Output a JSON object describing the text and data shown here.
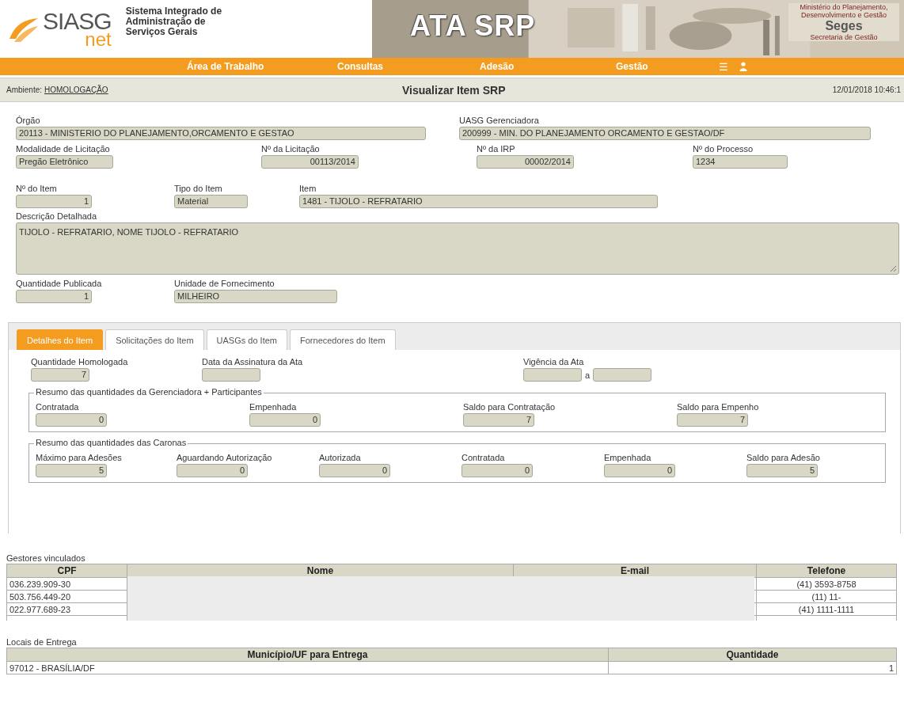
{
  "header": {
    "logo": {
      "text": "SIASG",
      "sub": "net"
    },
    "system_name": [
      "Sistema Integrado de",
      "Administração de",
      "Serviços Gerais"
    ],
    "banner_title": "ATA SRP",
    "ministry": {
      "lines": [
        "Ministério do Planejamento,",
        "Desenvolvimento e Gestão"
      ],
      "name": "Seges",
      "subtitle": "Secretaria de Gestão"
    }
  },
  "nav": {
    "items": [
      "Área de Trabalho",
      "Consultas",
      "Adesão",
      "Gestão"
    ],
    "menu_glyph": "☰"
  },
  "subbar": {
    "ambiente_label": "Ambiente:",
    "ambiente_value": "HOMOLOGAÇÃO",
    "title": "Visualizar Item SRP",
    "datetime": "12/01/2018 10:46:1"
  },
  "form": {
    "rows": [
      [
        {
          "label": "Órgão",
          "value": "20113 - MINISTERIO DO PLANEJAMENTO,ORCAMENTO E GESTAO",
          "kind": "text"
        },
        {
          "label": "UASG Gerenciadora",
          "value": "200999 - MIN. DO PLANEJAMENTO ORCAMENTO E GESTAO/DF",
          "kind": "text"
        }
      ],
      [
        {
          "label": "Modalidade de Licitação",
          "value": "Pregão Eletrônico",
          "kind": "text"
        },
        {
          "label": "Nº da Licitação",
          "value": "00113/2014",
          "kind": "number"
        },
        {
          "label": "Nº da IRP",
          "value": "00002/2014",
          "kind": "number"
        },
        {
          "label": "Nº do Processo",
          "value": "1234",
          "kind": "text"
        }
      ],
      [
        {
          "label": "Nº do Item",
          "value": "1",
          "kind": "number"
        },
        {
          "label": "Tipo do Item",
          "value": "Material",
          "kind": "text"
        },
        {
          "label": "Item",
          "value": "1481 - TIJOLO - REFRATARIO",
          "kind": "text"
        }
      ],
      [
        {
          "label": "Descrição Detalhada",
          "value": "TIJOLO - REFRATARIO, NOME TIJOLO - REFRATARIO",
          "kind": "textarea"
        }
      ],
      [
        {
          "label": "Quantidade Publicada",
          "value": "1",
          "kind": "number"
        },
        {
          "label": "Unidade de Fornecimento",
          "value": "MILHEIRO",
          "kind": "text"
        }
      ]
    ]
  },
  "tabs": [
    {
      "label": "Detalhes do Item",
      "selected": true
    },
    {
      "label": "Solicitações do Item",
      "selected": false
    },
    {
      "label": "UASGs do Item",
      "selected": false
    },
    {
      "label": "Fornecedores do Item",
      "selected": false
    }
  ],
  "details": {
    "top": [
      {
        "label": "Quantidade Homologada",
        "value": "7"
      },
      {
        "label": "Data da Assinatura da Ata"
      },
      {
        "label": "Vigência da Ata",
        "range_separator": "a"
      }
    ],
    "groups": [
      {
        "legend": "Resumo das quantidades da Gerenciadora + Participantes",
        "fields": [
          {
            "label": "Contratada",
            "value": "0"
          },
          {
            "label": "Empenhada",
            "value": "0"
          },
          {
            "label": "Saldo para Contratação",
            "value": "7"
          },
          {
            "label": "Saldo para Empenho",
            "value": "7"
          }
        ]
      },
      {
        "legend": "Resumo das quantidades das Caronas",
        "fields": [
          {
            "label": "Máximo para Adesões",
            "value": "5"
          },
          {
            "label": "Aguardando Autorização",
            "value": "0"
          },
          {
            "label": "Autorizada",
            "value": "0"
          },
          {
            "label": "Contratada",
            "value": "0"
          },
          {
            "label": "Empenhada",
            "value": "0"
          },
          {
            "label": "Saldo para Adesão",
            "value": "5"
          }
        ]
      }
    ]
  },
  "gestores": {
    "title": "Gestores vinculados",
    "columns": [
      "CPF",
      "Nome",
      "E-mail",
      "Telefone"
    ],
    "rows": [
      {
        "cpf": "036.239.909-30",
        "telefone": "(41) 3593-8758"
      },
      {
        "cpf": "503.756.449-20",
        "telefone": "(11) 11-"
      },
      {
        "cpf": "022.977.689-23",
        "telefone": "(41) 1111-1111"
      }
    ]
  },
  "locais": {
    "title": "Locais de Entrega",
    "columns": [
      "Município/UF para Entrega",
      "Quantidade"
    ],
    "rows": [
      {
        "municipio": "97012 - BRASÍLIA/DF",
        "quantidade": "1"
      }
    ]
  }
}
